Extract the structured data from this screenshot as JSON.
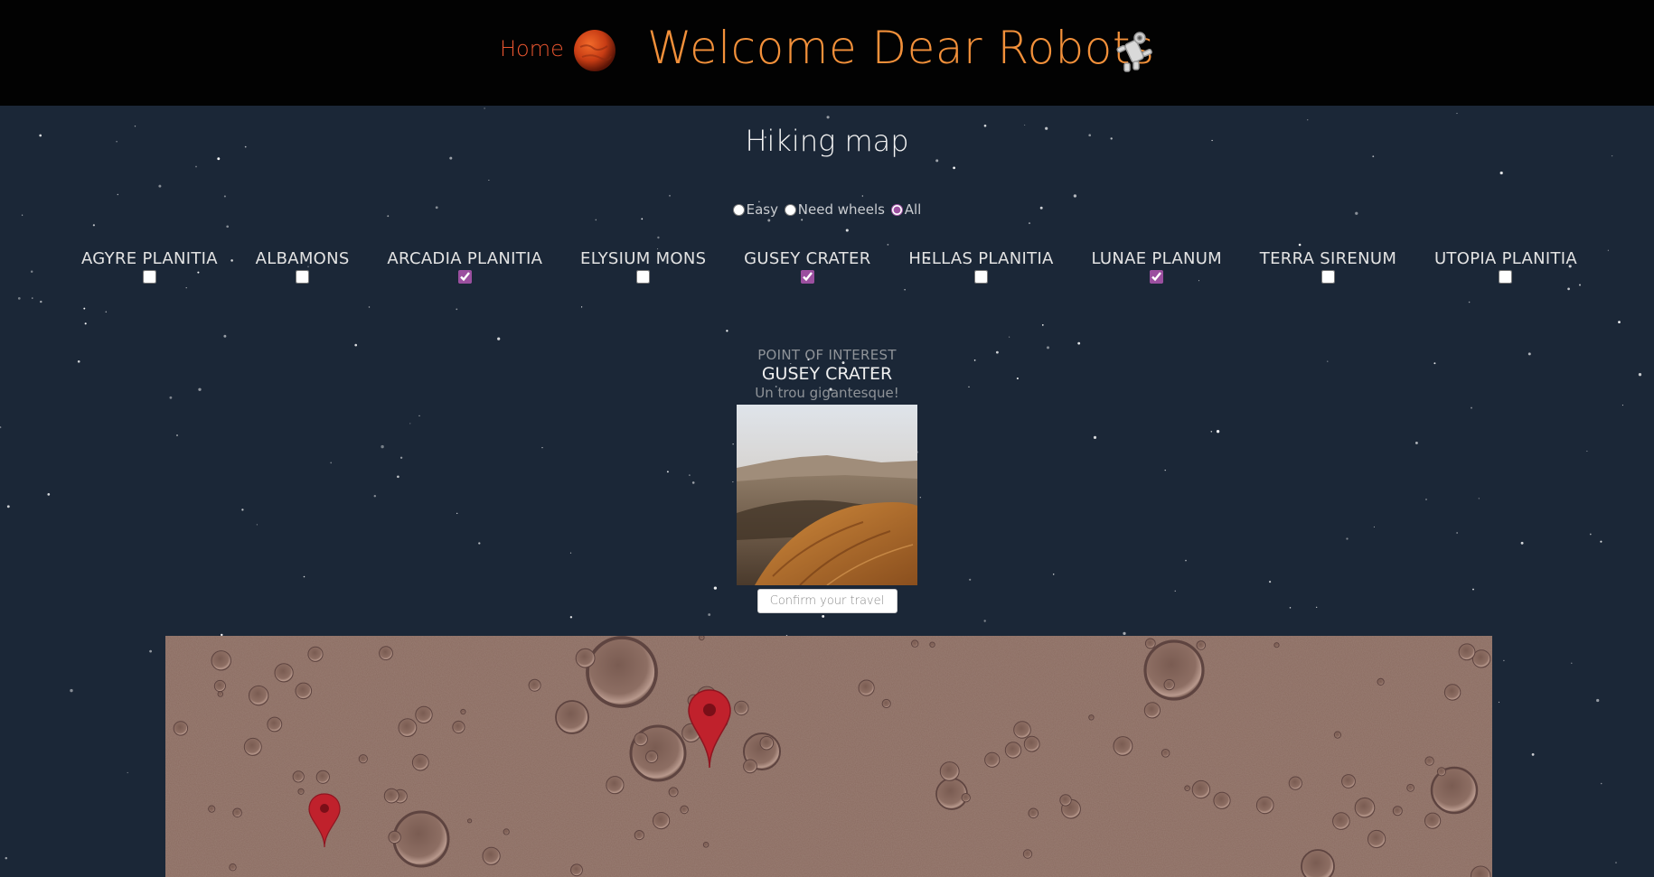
{
  "header": {
    "home_label": "Home",
    "title": "Welcome Dear Robots",
    "mars_icon": "mars-planet-icon",
    "robot_icon": "robot-icon"
  },
  "page": {
    "title": "Hiking map"
  },
  "difficulty": {
    "options": [
      {
        "label": "Easy",
        "selected": false
      },
      {
        "label": "Need wheels",
        "selected": false
      },
      {
        "label": "All",
        "selected": true
      }
    ]
  },
  "regions": [
    {
      "label": "AGYRE PLANITIA",
      "checked": false
    },
    {
      "label": "ALBAMONS",
      "checked": false
    },
    {
      "label": "ARCADIA PLANITIA",
      "checked": true
    },
    {
      "label": "ELYSIUM MONS",
      "checked": false
    },
    {
      "label": "GUSEY CRATER",
      "checked": true
    },
    {
      "label": "HELLAS PLANITIA",
      "checked": false
    },
    {
      "label": "LUNAE PLANUM",
      "checked": true
    },
    {
      "label": "TERRA SIRENUM",
      "checked": false
    },
    {
      "label": "UTOPIA PLANITIA",
      "checked": false
    }
  ],
  "poi": {
    "kicker": "POINT OF INTEREST",
    "name": "GUSEY CRATER",
    "description": "Un trou gigantesque!",
    "confirm_label": "Confirm your travel"
  },
  "colors": {
    "header_bg": "#020202",
    "page_bg": "#1b2737",
    "title_orange": "#f2903a",
    "home_orange": "#e8552f",
    "pin_red": "#c0212c",
    "checkbox_accent": "#9b4f9f"
  }
}
